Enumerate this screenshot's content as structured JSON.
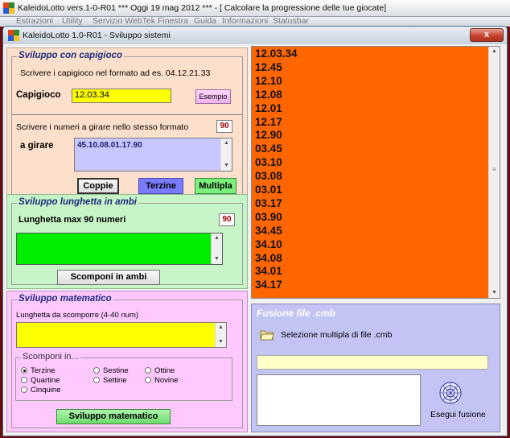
{
  "app": {
    "title": "KaleidoLotto vers.1-0-R01  ***  Oggi 19 mag 2012  ***   - [ Calcolare la progressione delle tue giocate]",
    "menu": [
      "Estrazioni",
      "Utility",
      "Servizio WebTek",
      "Finestra",
      "Guida",
      "Informazioni",
      "Statusbar"
    ]
  },
  "window": {
    "title": "KaleidoLotto 1.0-R01 - Sviluppo sistemi",
    "close_label": "x"
  },
  "capigioco_section": {
    "title": "Sviluppo con capigioco",
    "instruction": "Scrivere i capigioco nel formato ad es. 04.12.21.33",
    "capigioco_label": "Capigioco",
    "capigioco_value": "12.03.34",
    "esempio_label": "Esempio",
    "numeri_instruction": "Scrivere i numeri a girare nello stesso formato",
    "numeri_count": "90",
    "a_girare_label": "a girare",
    "a_girare_value": "45.10.08.01.17.90",
    "buttons": {
      "coppie": "Coppie",
      "terzine": "Terzine",
      "multipla": "Multipla"
    }
  },
  "lunghetta_section": {
    "title": "Sviluppo lunghetta in ambi",
    "label": "Lunghetta max 90 numeri",
    "count": "90",
    "textarea_value": "",
    "scomponi_label": "Scomponi in ambi"
  },
  "matematico_section": {
    "title": "Sviluppo matematico",
    "lunghetta_label": "Lunghetta da scomporre (4-40 num)",
    "textarea_value": "",
    "scomponi_group_title": "Scomponi in...",
    "options": [
      {
        "label": "Terzine",
        "selected": true
      },
      {
        "label": "Quartine",
        "selected": false
      },
      {
        "label": "Cinquine",
        "selected": false
      },
      {
        "label": "Sestine",
        "selected": false
      },
      {
        "label": "Settine",
        "selected": false
      },
      {
        "label": "Ottine",
        "selected": false
      },
      {
        "label": "Novine",
        "selected": false
      }
    ],
    "button_label": "Sviluppo matematico"
  },
  "results_list": {
    "items": [
      "12.03.34",
      "12.45",
      "12.10",
      "12.08",
      "12.01",
      "12.17",
      "12.90",
      "03.45",
      "03.10",
      "03.08",
      "03.01",
      "03.17",
      "03.90",
      "34.45",
      "34.10",
      "34.08",
      "34.01",
      "34.17"
    ]
  },
  "fusione_section": {
    "title": "Fusione file .cmb",
    "selezione_label": "Selezione multipla di file .cmb",
    "path_value": "",
    "esegui_label": "Esegui fusione"
  },
  "colors": {
    "capigioco_panel": "#fde0cc",
    "lunghetta_panel": "#c8f5c8",
    "matematico_panel": "#ffc8ff",
    "fusione_panel": "#c4c4f4",
    "list_bg": "#ff6600",
    "input_yellow": "#ffff00",
    "input_green": "#00ee00",
    "input_lavender": "#c8c8ff"
  }
}
